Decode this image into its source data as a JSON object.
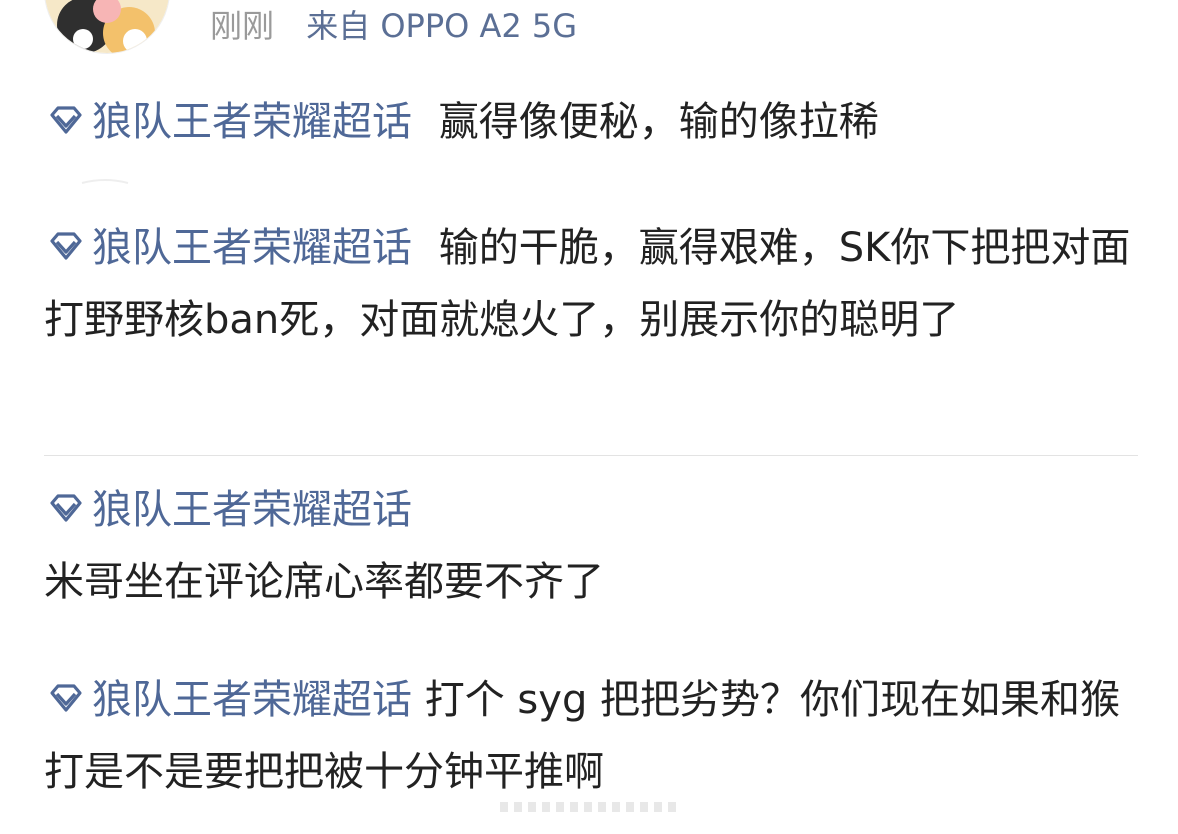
{
  "header": {
    "time": "刚刚",
    "source": "来自 OPPO A2 5G",
    "avatar_icon": "avatar-image"
  },
  "topic_tag": {
    "icon": "diamond-topic-icon",
    "label": "狼队王者荣耀超话",
    "color": "#4f6897"
  },
  "posts": [
    {
      "text": "赢得像便秘，输的像拉稀"
    },
    {
      "text": "输的干脆，赢得艰难，SK你下把把对面打野野核ban死，对面就熄火了，别展示你的聪明了"
    },
    {
      "text": "米哥坐在评论席心率都要不齐了"
    },
    {
      "text": "打个 syg 把把劣势？你们现在如果和猴打是不是要把把被十分钟平推啊"
    }
  ],
  "colors": {
    "link_blue": "#4f6897",
    "meta_gray": "#9a9a9a",
    "text": "#222222",
    "divider": "#e3e3e3"
  }
}
